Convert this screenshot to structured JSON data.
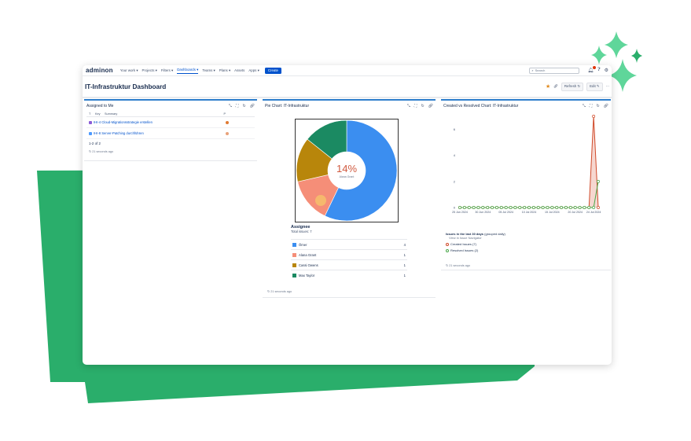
{
  "colors": {
    "green": "#2aae6b",
    "accent": "#0052cc",
    "pie_blue": "#3b8ef0",
    "pie_salmon": "#f58e78",
    "pie_olive": "#b8860b",
    "pie_teal": "#1b8a62"
  },
  "nav": {
    "logo": "adminon",
    "items": [
      "Your work",
      "Projects",
      "Filters",
      "Dashboards",
      "Teams",
      "Plans",
      "Assets",
      "Apps"
    ],
    "create": "Create",
    "search_placeholder": "Search"
  },
  "dashboard": {
    "title": "IT-Infrastruktur Dashboard",
    "refresh": "Refresh",
    "edit": "Edit"
  },
  "assigned": {
    "title": "Assigned to Me",
    "col_t": "T",
    "col_key": "Key",
    "col_summary": "Summary",
    "col_p": "P",
    "issues": [
      {
        "text": "IHI-4 Cloud-Migrationsstrategie erstellen",
        "color": "#8b5cd6"
      },
      {
        "text": "IHI-8 Server-Patching durchführen",
        "color": "#4c9aff"
      }
    ],
    "count": "1-2 of 2",
    "updated": "21 seconds ago"
  },
  "pie": {
    "title": "Pie Chart: IT-Infrastruktur",
    "center_percent": "14%",
    "center_label": "Alana Grant",
    "assignee_title": "Assignee",
    "total": "Total issues: 7",
    "updated": "21 seconds ago"
  },
  "cvr": {
    "title": "Created vs Resolved Chart: IT-Infrastruktur",
    "legend_title": "Issues in the last 30 days",
    "legend_suffix": "(grouped daily)",
    "legend_sub": "View in Issue Navigator",
    "created": "Created Issues (7)",
    "resolved": "Resolved Issues (2)",
    "updated": "21 seconds ago"
  },
  "chart_data": [
    {
      "type": "pie",
      "categories": [
        "Ömer",
        "Alana Grant",
        "Cassi Owens",
        "Max Taylor"
      ],
      "values": [
        4,
        1,
        1,
        1
      ],
      "colors": [
        "#3b8ef0",
        "#f58e78",
        "#b8860b",
        "#1b8a62"
      ]
    },
    {
      "type": "line",
      "x": [
        "25 Jun 2024",
        "26 Jun 2024",
        "27 Jun 2024",
        "28 Jun 2024",
        "29 Jun 2024",
        "30 Jun 2024",
        "01 Jul 2024",
        "02 Jul 2024",
        "03 Jul 2024",
        "04 Jul 2024",
        "05 Jul 2024",
        "06 Jul 2024",
        "07 Jul 2024",
        "08 Jul 2024",
        "09 Jul 2024",
        "10 Jul 2024",
        "11 Jul 2024",
        "12 Jul 2024",
        "13 Jul 2024",
        "14 Jul 2024",
        "15 Jul 2024",
        "16 Jul 2024",
        "17 Jul 2024",
        "18 Jul 2024",
        "19 Jul 2024",
        "20 Jul 2024",
        "21 Jul 2024",
        "22 Jul 2024",
        "23 Jul 2024",
        "24 Jul 2024",
        "25 Jul 2024"
      ],
      "x_tick_labels": [
        "25 Jun 2024",
        "30 Jun 2024",
        "05 Jul 2024",
        "10 Jul 2024",
        "15 Jul 2024",
        "20 Jul 2024",
        "24 Jul 2024"
      ],
      "y_ticks": [
        0,
        2,
        4,
        6
      ],
      "ylim": [
        0,
        7
      ],
      "series": [
        {
          "name": "Created Issues (7)",
          "color": "#d04a2a",
          "values": [
            0,
            0,
            0,
            0,
            0,
            0,
            0,
            0,
            0,
            0,
            0,
            0,
            0,
            0,
            0,
            0,
            0,
            0,
            0,
            0,
            0,
            0,
            0,
            0,
            0,
            0,
            0,
            0,
            0,
            7,
            0
          ]
        },
        {
          "name": "Resolved Issues (2)",
          "color": "#4aa84a",
          "values": [
            0,
            0,
            0,
            0,
            0,
            0,
            0,
            0,
            0,
            0,
            0,
            0,
            0,
            0,
            0,
            0,
            0,
            0,
            0,
            0,
            0,
            0,
            0,
            0,
            0,
            0,
            0,
            0,
            0,
            0,
            2
          ]
        }
      ]
    }
  ]
}
